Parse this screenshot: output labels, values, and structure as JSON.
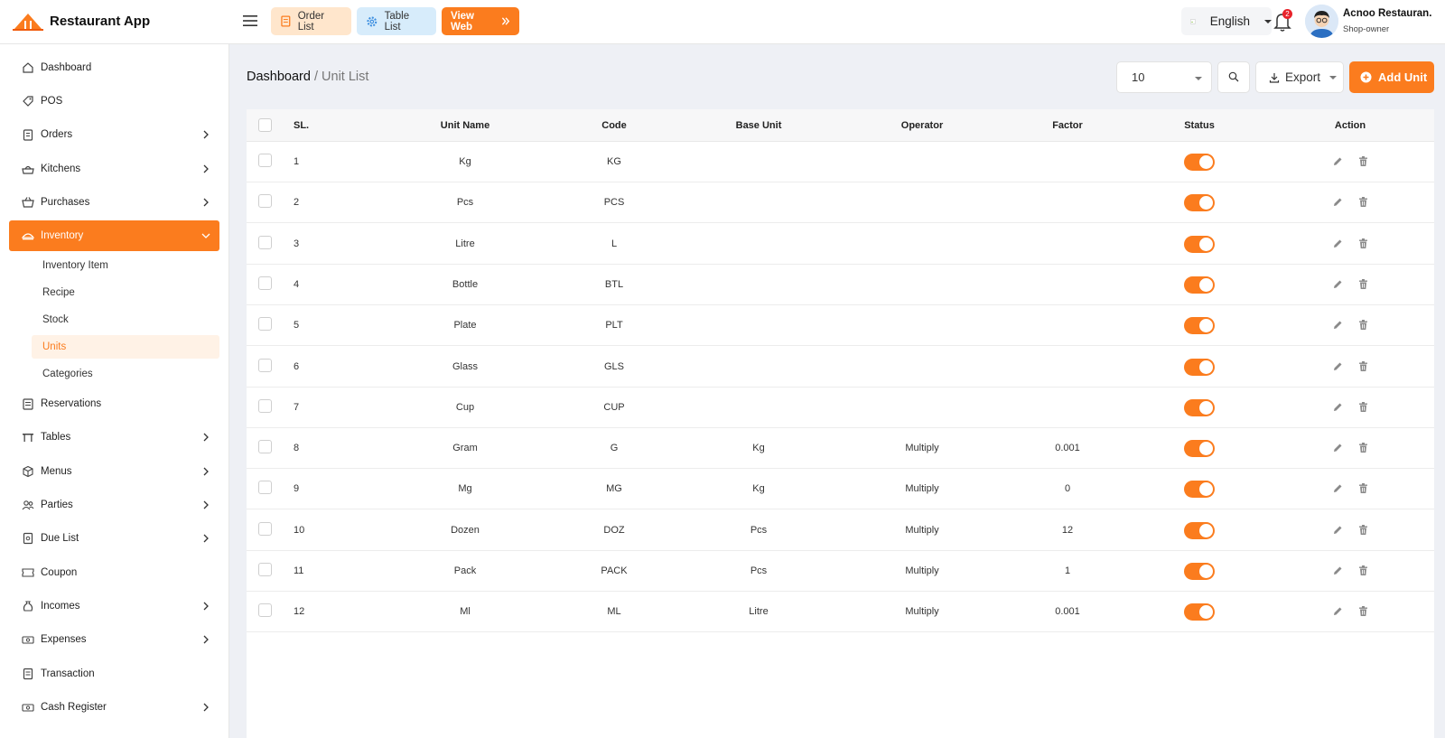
{
  "app": {
    "name": "Restaurant App",
    "accent": "#fb7c1e"
  },
  "topbar": {
    "order_list": "Order List",
    "table_list": "Table List",
    "view_web": "View Web",
    "language": "English",
    "notification_count": "2",
    "user_name": "Acnoo Restauran.",
    "user_role": "Shop-owner"
  },
  "sidebar": {
    "items": [
      {
        "label": "Dashboard"
      },
      {
        "label": "POS"
      },
      {
        "label": "Orders"
      },
      {
        "label": "Kitchens"
      },
      {
        "label": "Purchases"
      },
      {
        "label": "Inventory"
      },
      {
        "label": "Reservations"
      },
      {
        "label": "Tables"
      },
      {
        "label": "Menus"
      },
      {
        "label": "Parties"
      },
      {
        "label": "Due List"
      },
      {
        "label": "Coupon"
      },
      {
        "label": "Incomes"
      },
      {
        "label": "Expenses"
      },
      {
        "label": "Transaction"
      },
      {
        "label": "Cash Register"
      }
    ],
    "inventory_sub": [
      {
        "label": "Inventory Item"
      },
      {
        "label": "Recipe"
      },
      {
        "label": "Stock"
      },
      {
        "label": "Units"
      },
      {
        "label": "Categories"
      }
    ]
  },
  "breadcrumb": {
    "home": "Dashboard",
    "sep": " / ",
    "current": "Unit List"
  },
  "toolbar": {
    "per_page": "10",
    "export": "Export",
    "add": "Add Unit"
  },
  "table": {
    "headers": [
      "SL.",
      "Unit Name",
      "Code",
      "Base Unit",
      "Operator",
      "Factor",
      "Status",
      "Action"
    ],
    "rows": [
      {
        "sl": "1",
        "name": "Kg",
        "code": "KG",
        "base": "",
        "op": "",
        "factor": ""
      },
      {
        "sl": "2",
        "name": "Pcs",
        "code": "PCS",
        "base": "",
        "op": "",
        "factor": ""
      },
      {
        "sl": "3",
        "name": "Litre",
        "code": "L",
        "base": "",
        "op": "",
        "factor": ""
      },
      {
        "sl": "4",
        "name": "Bottle",
        "code": "BTL",
        "base": "",
        "op": "",
        "factor": ""
      },
      {
        "sl": "5",
        "name": "Plate",
        "code": "PLT",
        "base": "",
        "op": "",
        "factor": ""
      },
      {
        "sl": "6",
        "name": "Glass",
        "code": "GLS",
        "base": "",
        "op": "",
        "factor": ""
      },
      {
        "sl": "7",
        "name": "Cup",
        "code": "CUP",
        "base": "",
        "op": "",
        "factor": ""
      },
      {
        "sl": "8",
        "name": "Gram",
        "code": "G",
        "base": "Kg",
        "op": "Multiply",
        "factor": "0.001"
      },
      {
        "sl": "9",
        "name": "Mg",
        "code": "MG",
        "base": "Kg",
        "op": "Multiply",
        "factor": "0"
      },
      {
        "sl": "10",
        "name": "Dozen",
        "code": "DOZ",
        "base": "Pcs",
        "op": "Multiply",
        "factor": "12"
      },
      {
        "sl": "11",
        "name": "Pack",
        "code": "PACK",
        "base": "Pcs",
        "op": "Multiply",
        "factor": "1"
      },
      {
        "sl": "12",
        "name": "Ml",
        "code": "ML",
        "base": "Litre",
        "op": "Multiply",
        "factor": "0.001"
      }
    ]
  }
}
